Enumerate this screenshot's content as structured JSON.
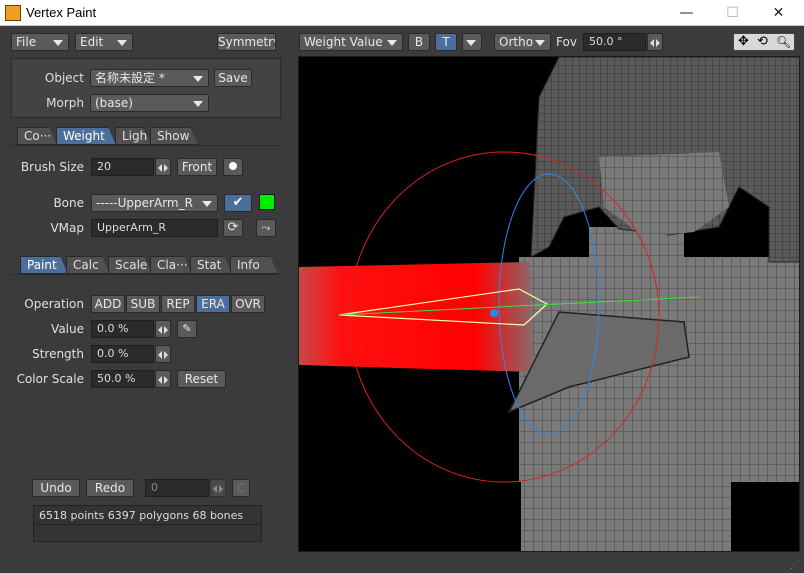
{
  "window": {
    "title": "Vertex Paint",
    "minimize": "—",
    "maximize": "☐",
    "close": "✕"
  },
  "menubar": {
    "file": "File",
    "edit": "Edit",
    "symmetry": "Symmetry"
  },
  "object_panel": {
    "object_label": "Object",
    "object_value": "名称未設定 *",
    "save_label": "Save",
    "morph_label": "Morph",
    "morph_value": "(base)"
  },
  "main_tabs": [
    {
      "label": "Co···",
      "active": false
    },
    {
      "label": "Weight",
      "active": true
    },
    {
      "label": "Light",
      "active": false
    },
    {
      "label": "Show",
      "active": false
    }
  ],
  "brush": {
    "label": "Brush Size",
    "value": "20",
    "front_label": "Front"
  },
  "bone": {
    "label": "Bone",
    "value": "-----UpperArm_R",
    "color": "#00ee00"
  },
  "vmap": {
    "label": "VMap",
    "value": "UpperArm_R"
  },
  "sub_tabs": [
    {
      "label": "Paint",
      "active": true
    },
    {
      "label": "Calc",
      "active": false
    },
    {
      "label": "Scale",
      "active": false
    },
    {
      "label": "Cla···",
      "active": false
    },
    {
      "label": "Stat",
      "active": false
    },
    {
      "label": "Info",
      "active": false
    }
  ],
  "operation": {
    "label": "Operation",
    "modes": [
      {
        "label": "ADD",
        "active": false
      },
      {
        "label": "SUB",
        "active": false
      },
      {
        "label": "REP",
        "active": false
      },
      {
        "label": "ERA",
        "active": true
      },
      {
        "label": "OVR",
        "active": false
      }
    ]
  },
  "params": {
    "value_label": "Value",
    "value": "0.0 %",
    "strength_label": "Strength",
    "strength": "0.0 %",
    "colorscale_label": "Color Scale",
    "colorscale": "50.0 %",
    "reset_label": "Reset"
  },
  "history": {
    "undo": "Undo",
    "redo": "Redo",
    "counter": "0",
    "clear": "C"
  },
  "status": {
    "text": "6518 points  6397 polygons  68 bones"
  },
  "viewport_toolbar": {
    "mode": "Weight Value",
    "b_label": "B",
    "t_label": "T",
    "projection": "Ortho",
    "fov_label": "Fov",
    "fov_value": "50.0 °"
  },
  "colors": {
    "accent": "#4b6f9a",
    "bone_color": "#00ee00",
    "paint": "#ff0000"
  }
}
